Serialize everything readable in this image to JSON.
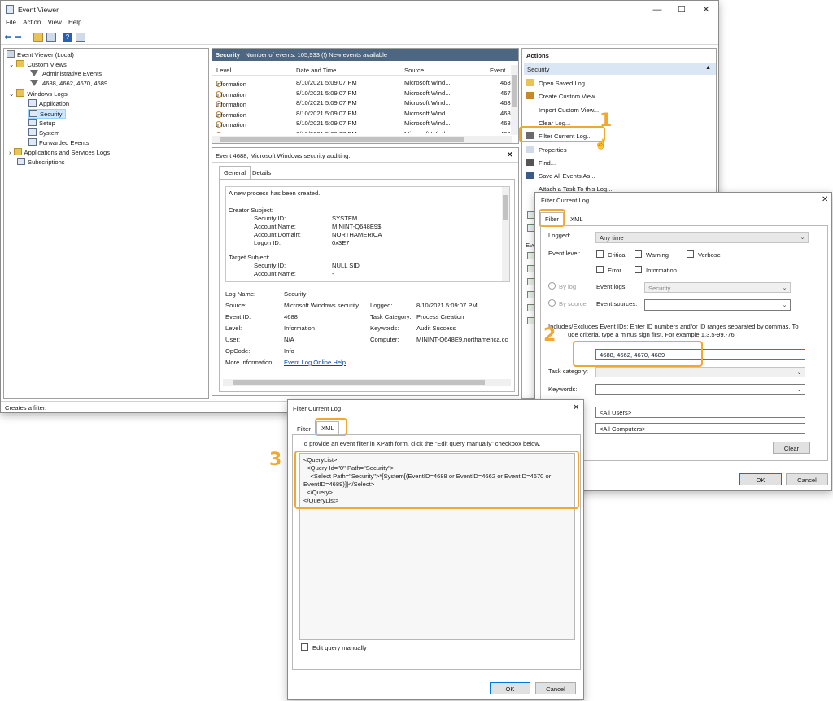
{
  "main_window": {
    "title": "Event Viewer",
    "menu": [
      "File",
      "Action",
      "View",
      "Help"
    ],
    "status": "Creates a filter."
  },
  "tree": {
    "root": "Event Viewer (Local)",
    "custom_views": "Custom Views",
    "admin_events": "Administrative Events",
    "custom_view_item": "4688, 4662, 4670, 4689",
    "windows_logs": "Windows Logs",
    "logs": [
      "Application",
      "Security",
      "Setup",
      "System",
      "Forwarded Events"
    ],
    "apps_services": "Applications and Services Logs",
    "subscriptions": "Subscriptions"
  },
  "events_pane": {
    "header_name": "Security",
    "header_count": "Number of events: 105,933 (!) New events available",
    "columns": [
      "Level",
      "Date and Time",
      "Source",
      "Event"
    ],
    "rows": [
      {
        "level": "Information",
        "date": "8/10/2021 5:09:07 PM",
        "source": "Microsoft Wind...",
        "event": "468"
      },
      {
        "level": "Information",
        "date": "8/10/2021 5:09:07 PM",
        "source": "Microsoft Wind...",
        "event": "467"
      },
      {
        "level": "Information",
        "date": "8/10/2021 5:09:07 PM",
        "source": "Microsoft Wind...",
        "event": "468"
      },
      {
        "level": "Information",
        "date": "8/10/2021 5:09:07 PM",
        "source": "Microsoft Wind...",
        "event": "468"
      },
      {
        "level": "Information",
        "date": "8/10/2021 5:09:07 PM",
        "source": "Microsoft Wind...",
        "event": "468"
      },
      {
        "level": "Information",
        "date": "8/10/2021 5:09:07 PM",
        "source": "Microsoft Wind...",
        "event": "468"
      }
    ]
  },
  "details_pane": {
    "title": "Event 4688, Microsoft Windows security auditing.",
    "tabs": [
      "General",
      "Details"
    ],
    "message": {
      "intro": "A new process has been created.",
      "creator_subject": "Creator Subject:",
      "creator_fields": [
        {
          "k": "Security ID:",
          "v": "SYSTEM"
        },
        {
          "k": "Account Name:",
          "v": "MININT-Q648E9$"
        },
        {
          "k": "Account Domain:",
          "v": "NORTHAMERICA"
        },
        {
          "k": "Logon ID:",
          "v": "0x3E7"
        }
      ],
      "target_subject": "Target Subject:",
      "target_fields": [
        {
          "k": "Security ID:",
          "v": "NULL SID"
        },
        {
          "k": "Account Name:",
          "v": "-"
        }
      ]
    },
    "props_left": [
      {
        "k": "Log Name:",
        "v": "Security"
      },
      {
        "k": "Source:",
        "v": "Microsoft Windows security"
      },
      {
        "k": "Event ID:",
        "v": "4688"
      },
      {
        "k": "Level:",
        "v": "Information"
      },
      {
        "k": "User:",
        "v": "N/A"
      },
      {
        "k": "OpCode:",
        "v": "Info"
      },
      {
        "k": "More Information:",
        "v": "Event Log Online Help"
      }
    ],
    "props_right": [
      {
        "k": "Logged:",
        "v": "8/10/2021 5:09:07 PM"
      },
      {
        "k": "Task Category:",
        "v": "Process Creation"
      },
      {
        "k": "Keywords:",
        "v": "Audit Success"
      },
      {
        "k": "Computer:",
        "v": "MININT-Q648E9.northamerica.cc"
      }
    ]
  },
  "actions_pane": {
    "title": "Actions",
    "section": "Security",
    "items": [
      "Open Saved Log...",
      "Create Custom View...",
      "Import Custom View...",
      "Clear Log...",
      "Filter Current Log...",
      "Properties",
      "Find...",
      "Save All Events As...",
      "Attach a Task To this Log..."
    ],
    "partial_section": "Eve"
  },
  "filter_dialog": {
    "title": "Filter Current Log",
    "tabs": [
      "Filter",
      "XML"
    ],
    "logged_label": "Logged:",
    "logged_value": "Any time",
    "event_level_label": "Event level:",
    "levels": [
      "Critical",
      "Warning",
      "Verbose",
      "Error",
      "Information"
    ],
    "by_log": "By log",
    "by_source": "By source",
    "event_logs_label": "Event logs:",
    "event_logs_value": "Security",
    "event_sources_label": "Event sources:",
    "ids_help_1": "Includes/Excludes Event IDs: Enter ID numbers and/or ID ranges separated by commas. To",
    "ids_help_2": "ude criteria, type a minus sign first. For example 1,3,5-99,-76",
    "ids_value": "4688, 4662, 4670, 4689",
    "task_category_label": "Task category:",
    "keywords_label": "Keywords:",
    "user_value": "<All Users>",
    "computer_value": "<All Computers>",
    "clear_label": "Clear",
    "ok_label": "OK",
    "cancel_label": "Cancel"
  },
  "xml_dialog": {
    "title": "Filter Current Log",
    "tabs": [
      "Filter",
      "XML"
    ],
    "instruction": "To provide an event filter in XPath form, click the \"Edit query manually\" checkbox below.",
    "query": "<QueryList>\n  <Query Id=\"0\" Path=\"Security\">\n    <Select Path=\"Security\">*[System[(EventID=4688 or EventID=4662 or EventID=4670 or\nEventID=4689)]]</Select>\n  </Query>\n</QueryList>",
    "edit_manually": "Edit query manually",
    "ok_label": "OK",
    "cancel_label": "Cancel"
  },
  "callouts": [
    "1",
    "2",
    "3"
  ]
}
